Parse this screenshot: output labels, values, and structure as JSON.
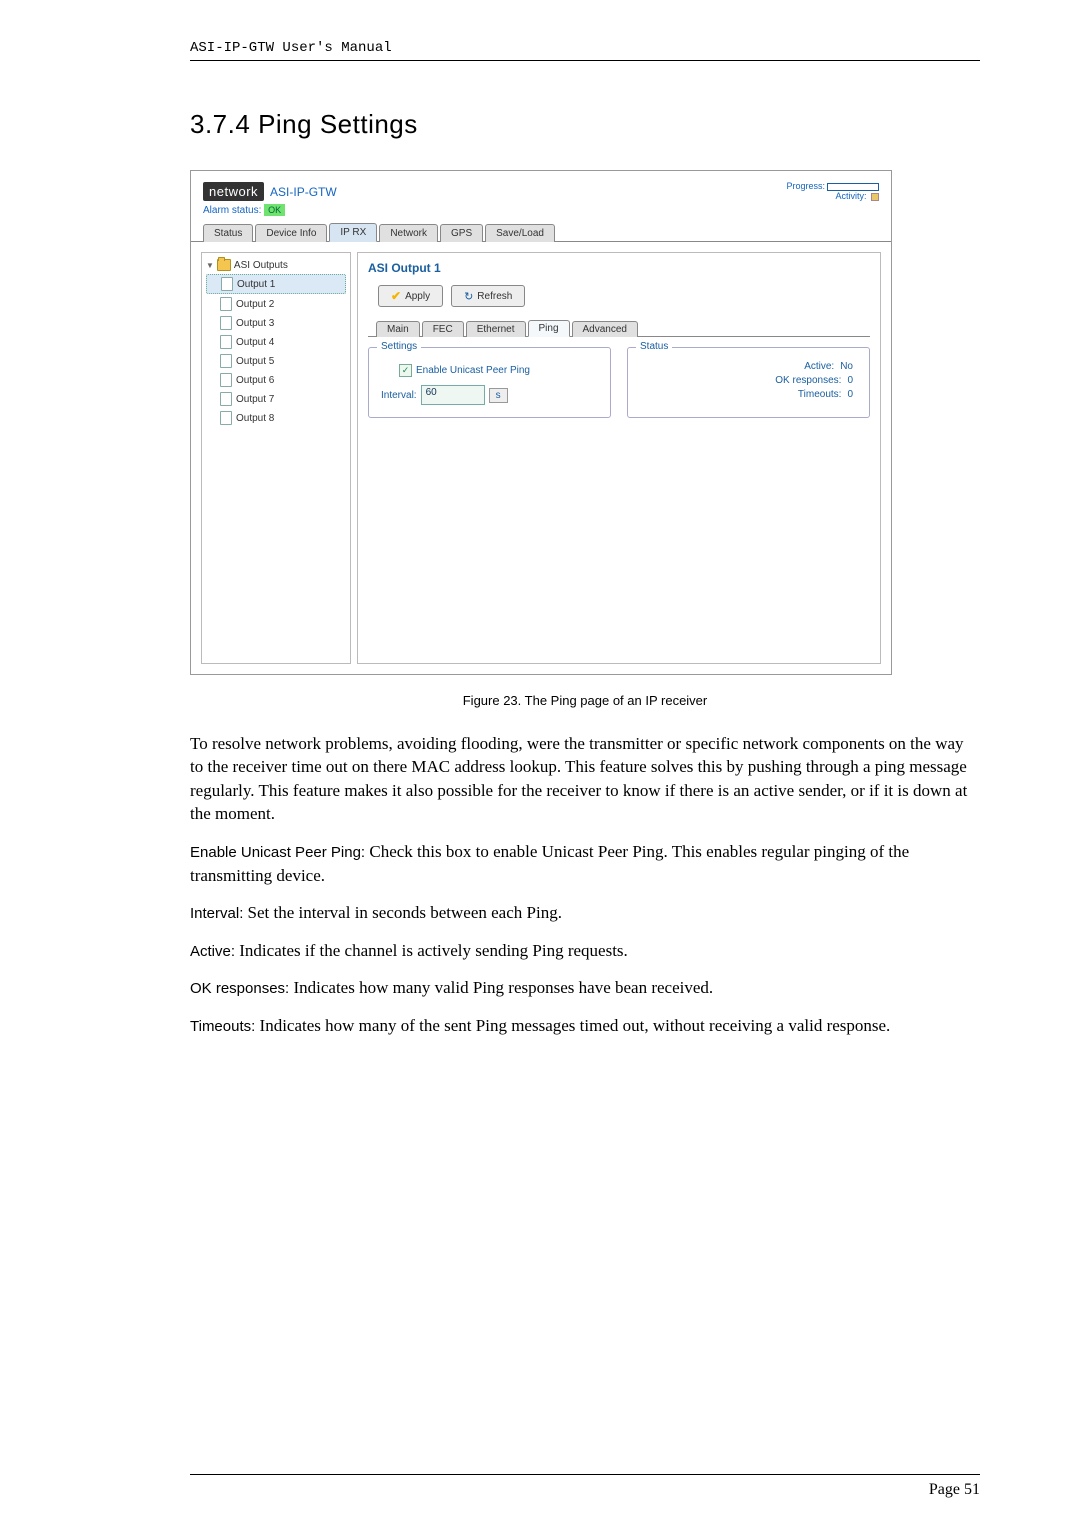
{
  "doc_header": "ASI-IP-GTW User's Manual",
  "section_number": "3.7.4",
  "section_name": "Ping Settings",
  "app": {
    "logo": "network",
    "product": "ASI-IP-GTW",
    "progress_label": "Progress:",
    "activity_label": "Activity:",
    "alarm_label": "Alarm status:",
    "alarm_value": "OK",
    "nav_tabs": [
      "Status",
      "Device Info",
      "IP RX",
      "Network",
      "GPS",
      "Save/Load"
    ],
    "nav_active_index": 2,
    "tree_root": "ASI Outputs",
    "tree_items": [
      "Output 1",
      "Output 2",
      "Output 3",
      "Output 4",
      "Output 5",
      "Output 6",
      "Output 7",
      "Output 8"
    ],
    "tree_selected_index": 0,
    "content_title": "ASI Output 1",
    "apply_btn": "Apply",
    "refresh_btn": "Refresh",
    "sub_tabs": [
      "Main",
      "FEC",
      "Ethernet",
      "Ping",
      "Advanced"
    ],
    "sub_active_index": 3,
    "settings_legend": "Settings",
    "enable_label": "Enable Unicast Peer Ping",
    "enable_checked": true,
    "interval_label": "Interval:",
    "interval_value": "60",
    "interval_unit": "s",
    "status_legend": "Status",
    "status_active_label": "Active:",
    "status_active_value": "No",
    "status_ok_label": "OK responses:",
    "status_ok_value": "0",
    "status_timeouts_label": "Timeouts:",
    "status_timeouts_value": "0"
  },
  "figure_caption": "Figure 23. The Ping page of an IP receiver",
  "para1": "To resolve network problems, avoiding flooding, were the transmitter or specific network components on the way to the receiver time out on there MAC address lookup. This feature solves this by pushing through a ping message regularly. This feature makes it also possible for the receiver to know if there is an active sender, or if it is down at the moment.",
  "term_enable": "Enable Unicast Peer Ping:",
  "para_enable": " Check this box to enable Unicast Peer Ping. This enables regular pinging of the transmitting device.",
  "term_interval": "Interval: ",
  "para_interval": " Set the interval in seconds between each Ping.",
  "term_active": "Active:",
  "para_active": " Indicates if the channel is actively sending Ping requests.",
  "term_ok": "OK responses:",
  "para_ok": " Indicates how many valid Ping responses have bean received.",
  "term_timeouts": "Timeouts:",
  "para_timeouts": " Indicates how many of the sent Ping messages timed out, without receiving a valid response.",
  "page_label": "Page 51"
}
